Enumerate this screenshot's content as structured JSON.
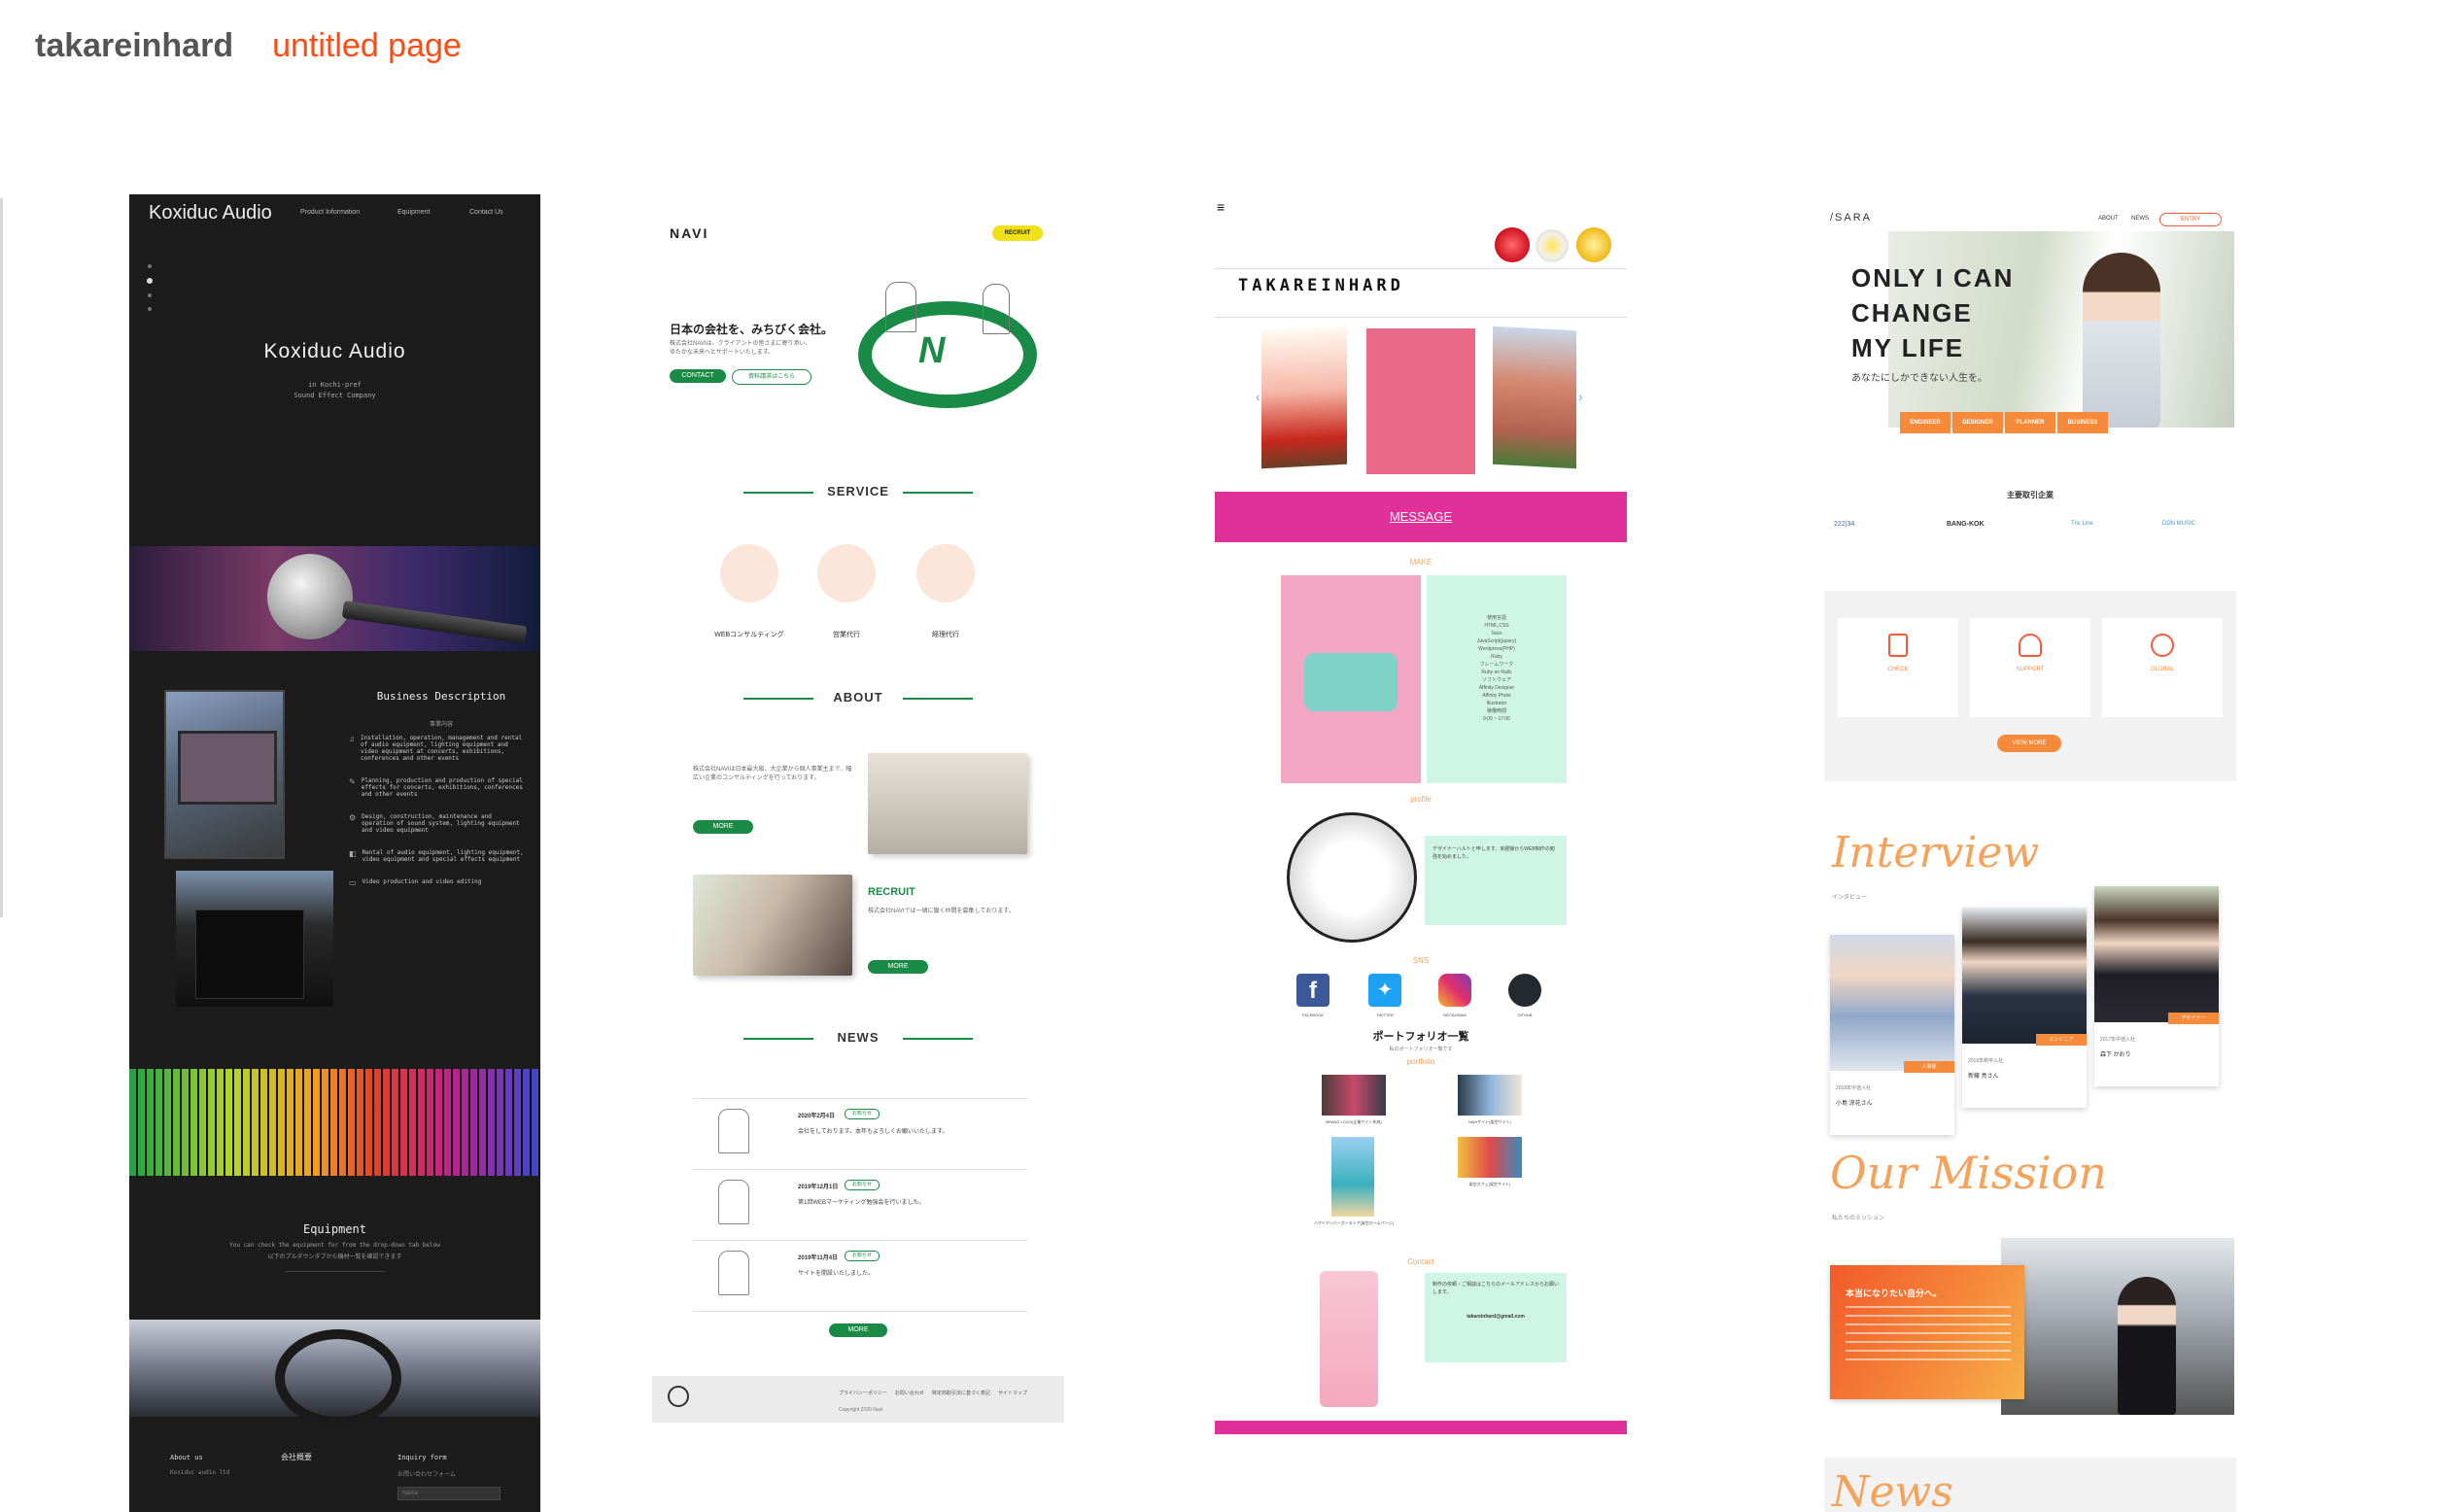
{
  "header": {
    "site_name": "takareinhard",
    "page_name": "untitled page"
  },
  "colors": {
    "accent": "#ff4a12",
    "navi_green": "#1a8a47",
    "magenta": "#e0309a",
    "sara_orange": "#f58a3a"
  },
  "card1": {
    "logo": "Koxiduc Audio",
    "nav": [
      "Product Information",
      "Equipment",
      "Contact Us"
    ],
    "hero_title": "Koxiduc Audio",
    "hero_sub1": "in Kochi-pref",
    "hero_sub2": "Sound Effect Company",
    "business_title": "Business Description",
    "business_jp": "事業内容",
    "services": [
      "Installation, operation, management and rental of audio equipment, lighting equipment and video equipment at concerts, exhibitions, conferences and other events",
      "Planning, production and production of special effects for concerts, exhibitions, conferences and other events",
      "Design, construction, maintenance and operation of sound system, lighting equipment and video equipment",
      "Rental of audio equipment, lighting equipment, video equipment and special effects equipment",
      "Video production and video editing"
    ],
    "equipment_title": "Equipment",
    "equipment_text": "You can check the equipment for from the drop-down tab below",
    "equipment_jp": "以下のプルダウンタブから機材一覧を確認できます",
    "footer": {
      "about": "About us",
      "company": "会社概要",
      "inquiry": "Inquiry form",
      "company_name": "Koxiduc audio ltd",
      "inquiry_jp": "お問い合わせフォーム",
      "name_placeholder": "Name"
    }
  },
  "card2": {
    "logo": "NAVI",
    "recruit_badge": "RECRUIT",
    "hero_title": "日本の会社を、みちびく会社。",
    "hero_text": "株式会社NAVIは、クライアントの皆さまに寄り添い、ゆたかな未来へとサポートいたします。",
    "btn_contact": "CONTACT",
    "btn_docs": "資料請求はこちら",
    "service_title": "SERVICE",
    "services": [
      "WEBコンサルティング",
      "営業代行",
      "経理代行"
    ],
    "about_title": "ABOUT",
    "about_text": "株式会社NAVIは日本最大級、大企業から個人事業主まで、幅広い企業のコンサルティングを行っております。",
    "more": "MORE",
    "recruit_title": "RECRUIT",
    "recruit_text": "株式会社NAVIでは一緒に働く仲間を募集しております。",
    "news_title": "NEWS",
    "news": [
      {
        "date": "2020年2月4日",
        "tag": "お知らせ",
        "title": "会社をしております。本年もよろしくお願いいたします。"
      },
      {
        "date": "2019年12月1日",
        "tag": "お知らせ",
        "title": "第1回WEBマーケティング勉強会を行いました。"
      },
      {
        "date": "2019年11月4日",
        "tag": "お知らせ",
        "title": "サイトを開設いたしました。"
      }
    ],
    "footer_links": [
      "プライバシーポリシー",
      "お問い合わせ",
      "特定商取引法に基づく表記",
      "サイトマップ"
    ],
    "copyright": "Copyright 2020 Navi"
  },
  "card3": {
    "menu_icon": "hamburger-icon",
    "brand": "TAKAREINHARD",
    "message": "MESSAGE",
    "make": "MAKE",
    "skills": [
      "使用言語",
      "HTML,CSS",
      "Sass",
      "JavaScript(jquery)",
      "Wordpress(PHP)",
      "Ruby",
      "フレームワーク",
      "Ruby on Rails",
      "ソフトウェア",
      "Affinity Designer",
      "Affinity Photo",
      "Illustrator",
      "稼働時間",
      "9:00 ~ 17:00"
    ],
    "profile": "profile",
    "profile_text": "デザイナーハルトと申します。未経験からWEB制作の勉強を始めました。",
    "sns": "SNS",
    "sns_items": [
      "FACEBOOK",
      "TWITTER",
      "INSTAGRAM",
      "GITHUB"
    ],
    "portfolio_title": "ポートフォリオ一覧",
    "portfolio_sub": "私のポートフォリオ一覧です",
    "portfolio": "portfolio",
    "works": [
      "BRAND LOGO(企業サイト作成)",
      "NAVIサイト(架空サイト)",
      "ハワイアンバーガーストア(架空ホームページ)",
      "架空カフェ(架空サイト)"
    ],
    "contact": "Contact",
    "contact_text": "制作の依頼・ご相談はこちらのメールアドレスからお願いします。",
    "email": "takareinhard@gmail.com"
  },
  "card4": {
    "logo": "/SARA",
    "nav": [
      "ABOUT",
      "NEWS"
    ],
    "entry": "ENTRY",
    "hero_line1": "ONLY I CAN",
    "hero_line2": "CHANGE",
    "hero_line3": "MY LIFE",
    "hero_sub": "あなたにしかできない人生を。",
    "jobs": [
      "ENGINEER",
      "DESIGNER",
      "PLANNER",
      "BUSINESS"
    ],
    "clients_title": "主要取引企業",
    "clients": [
      "222|34",
      "BANG-KOK",
      "Tric Line",
      "DDN MUSIC"
    ],
    "values": [
      "CHECK",
      "SUPPORT",
      "GLOBAL"
    ],
    "view_more": "VIEW MORE",
    "interview": "Interview",
    "interview_jp": "インタビュー",
    "people": [
      {
        "year": "2018年中途入社",
        "name": "小島 涼花さん",
        "role": "人事部"
      },
      {
        "year": "2019年新卒入社",
        "name": "新藤 亮さん",
        "role": "エンジニア"
      },
      {
        "year": "2017年中途入社",
        "name": "森下 かおり",
        "role": "デザイナー"
      }
    ],
    "mission": "Our Mission",
    "mission_jp": "私たちのミッション",
    "mission_text": "本当になりたい自分へ。",
    "news": "News"
  }
}
